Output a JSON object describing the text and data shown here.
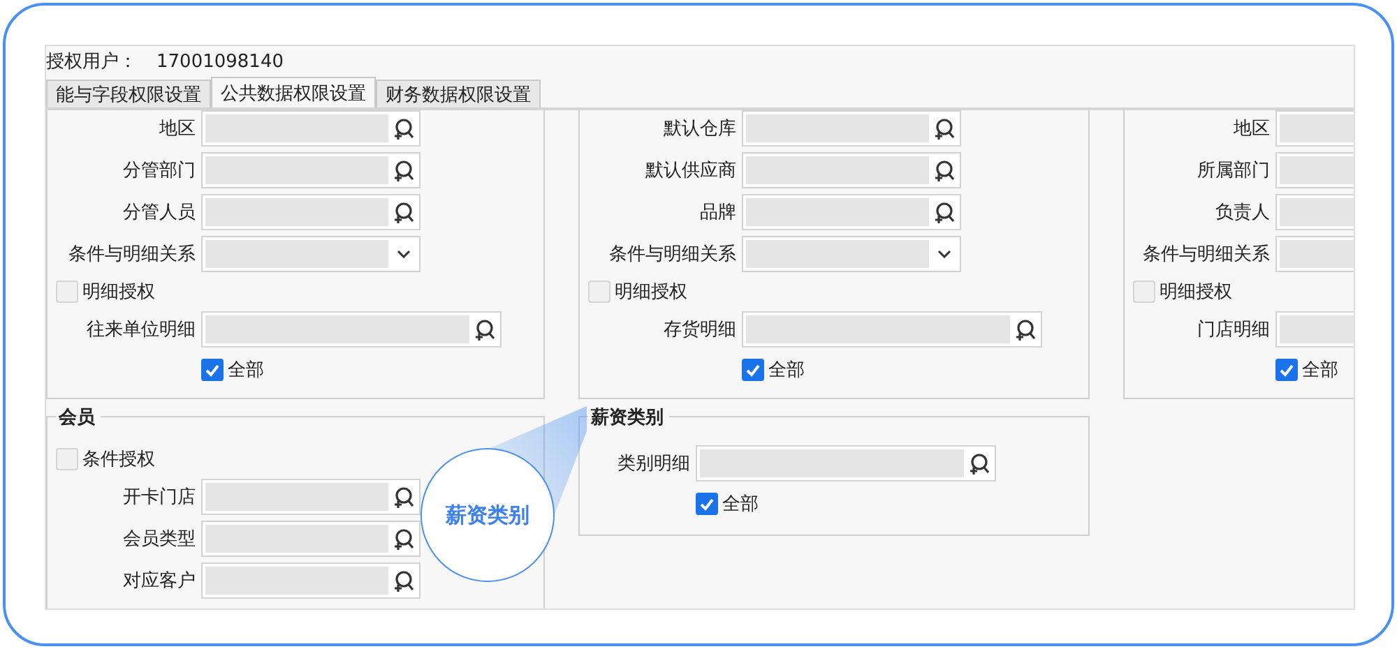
{
  "header": {
    "label": "授权用户：",
    "value": "17001098140"
  },
  "tabs": [
    {
      "label": "能与字段权限设置",
      "selected": false
    },
    {
      "label": "公共数据权限设置",
      "selected": true
    },
    {
      "label": "财务数据权限设置",
      "selected": false
    }
  ],
  "columns": [
    {
      "groups": [
        {
          "rows": [
            {
              "kind": "search",
              "label": "地区"
            },
            {
              "kind": "search",
              "label": "分管部门"
            },
            {
              "kind": "search",
              "label": "分管人员"
            },
            {
              "kind": "select",
              "label": "条件与明细关系"
            },
            {
              "kind": "check",
              "label": "明细授权",
              "checked": false
            },
            {
              "kind": "detail",
              "label": "往来单位明细"
            },
            {
              "kind": "all",
              "label": "全部",
              "checked": true
            }
          ]
        },
        {
          "title": "会员",
          "rows": [
            {
              "kind": "check",
              "label": "条件授权",
              "checked": false
            },
            {
              "kind": "search",
              "label": "开卡门店"
            },
            {
              "kind": "search",
              "label": "会员类型"
            },
            {
              "kind": "search",
              "label": "对应客户"
            }
          ]
        }
      ]
    },
    {
      "groups": [
        {
          "rows": [
            {
              "kind": "search",
              "label": "默认仓库"
            },
            {
              "kind": "search",
              "label": "默认供应商"
            },
            {
              "kind": "search",
              "label": "品牌"
            },
            {
              "kind": "select",
              "label": "条件与明细关系"
            },
            {
              "kind": "check",
              "label": "明细授权",
              "checked": false
            },
            {
              "kind": "detail",
              "label": "存货明细"
            },
            {
              "kind": "all",
              "label": "全部",
              "checked": true
            }
          ]
        },
        {
          "title": "薪资类别",
          "rows": [
            {
              "kind": "detail",
              "label": "类别明细"
            },
            {
              "kind": "all",
              "label": "全部",
              "checked": true
            }
          ]
        }
      ]
    },
    {
      "groups": [
        {
          "rows": [
            {
              "kind": "search",
              "label": "地区"
            },
            {
              "kind": "search",
              "label": "所属部门"
            },
            {
              "kind": "search",
              "label": "负责人"
            },
            {
              "kind": "select",
              "label": "条件与明细关系"
            },
            {
              "kind": "check",
              "label": "明细授权",
              "checked": false
            },
            {
              "kind": "detail",
              "label": "门店明细"
            },
            {
              "kind": "all",
              "label": "全部",
              "checked": true
            }
          ]
        }
      ]
    }
  ],
  "callout": {
    "text": "薪资类别"
  }
}
